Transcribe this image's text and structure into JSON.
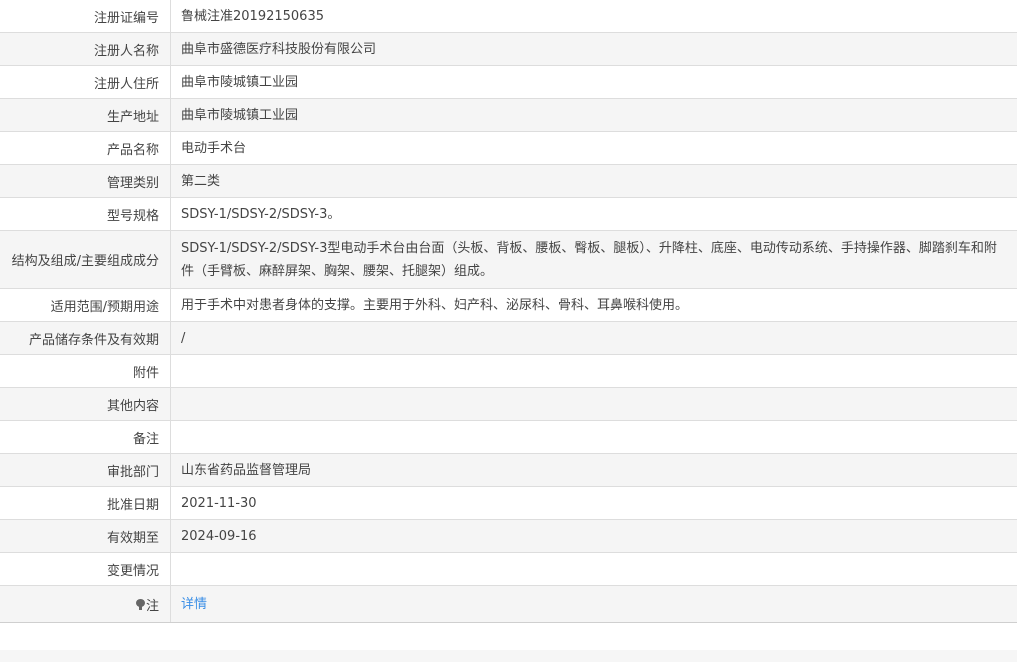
{
  "rows": [
    {
      "label": "注册证编号",
      "value": "鲁械注准20192150635"
    },
    {
      "label": "注册人名称",
      "value": "曲阜市盛德医疗科技股份有限公司"
    },
    {
      "label": "注册人住所",
      "value": "曲阜市陵城镇工业园"
    },
    {
      "label": "生产地址",
      "value": "曲阜市陵城镇工业园"
    },
    {
      "label": "产品名称",
      "value": "电动手术台"
    },
    {
      "label": "管理类别",
      "value": "第二类"
    },
    {
      "label": "型号规格",
      "value": "SDSY-1/SDSY-2/SDSY-3。"
    },
    {
      "label": "结构及组成/主要组成成分",
      "value": "SDSY-1/SDSY-2/SDSY-3型电动手术台由台面（头板、背板、腰板、臀板、腿板）、升降柱、底座、电动传动系统、手持操作器、脚踏刹车和附件（手臂板、麻醉屏架、胸架、腰架、托腿架）组成。"
    },
    {
      "label": "适用范围/预期用途",
      "value": "用于手术中对患者身体的支撑。主要用于外科、妇产科、泌尿科、骨科、耳鼻喉科使用。"
    },
    {
      "label": "产品储存条件及有效期",
      "value": "/"
    },
    {
      "label": "附件",
      "value": ""
    },
    {
      "label": "其他内容",
      "value": ""
    },
    {
      "label": "备注",
      "value": ""
    },
    {
      "label": "审批部门",
      "value": "山东省药品监督管理局"
    },
    {
      "label": "批准日期",
      "value": "2021-11-30"
    },
    {
      "label": "有效期至",
      "value": "2024-09-16"
    },
    {
      "label": "变更情况",
      "value": ""
    }
  ],
  "note_row": {
    "icon": "lightbulb-icon",
    "label": "注",
    "link": "详情"
  },
  "colors": {
    "row_alt_bg": "#f5f5f5",
    "border": "#dddddd",
    "text": "#444444",
    "link": "#3a8ee6"
  }
}
